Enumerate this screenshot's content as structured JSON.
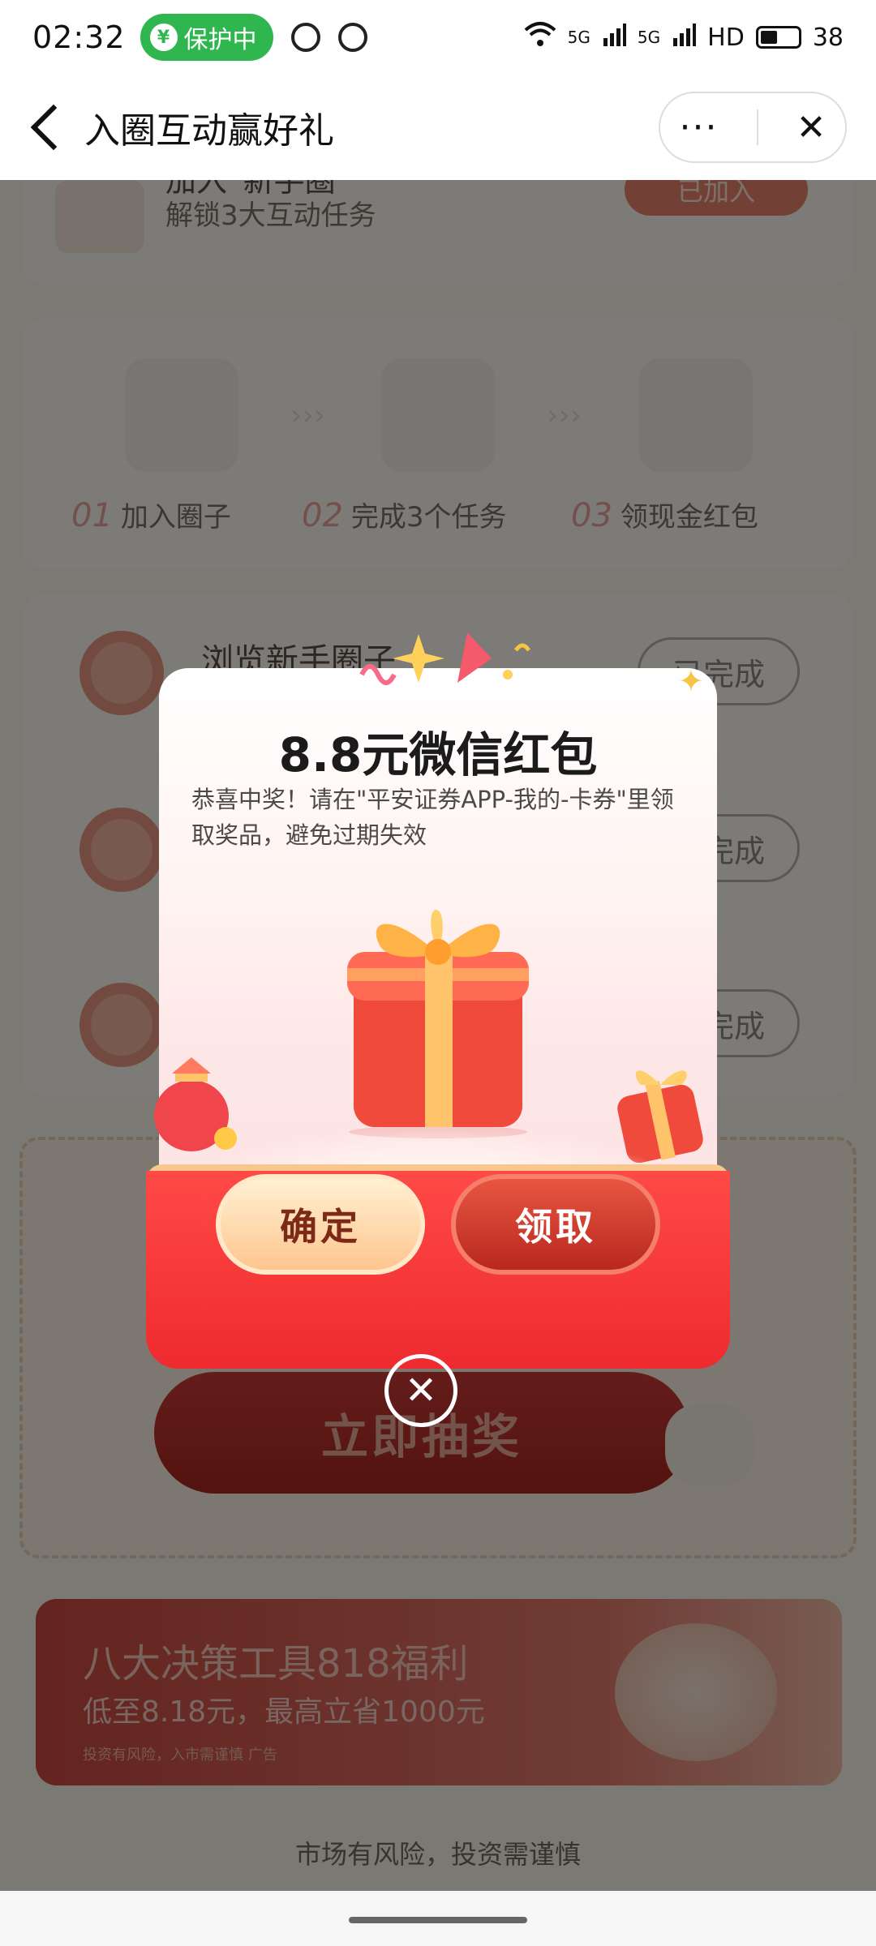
{
  "status_bar": {
    "time": "02:32",
    "protect_label": "保护中",
    "protect_icon": "shield-yen-icon",
    "battery": "38",
    "network_label": "5G",
    "hd_label": "HD"
  },
  "header": {
    "title": "入圈互动赢好礼",
    "more_label": "···",
    "close_label": "✕"
  },
  "background": {
    "card1": {
      "title": "加入“新手圈”",
      "subtitle": "解锁3大互动任务",
      "button": "已加入"
    },
    "steps": [
      {
        "num": "01",
        "label": "加入圈子"
      },
      {
        "num": "02",
        "label": "完成3个任务"
      },
      {
        "num": "03",
        "label": "领现金红包"
      }
    ],
    "tasks": [
      {
        "title": "浏览新手圈子",
        "button": "已完成"
      },
      {
        "title": "",
        "button": "已完成"
      },
      {
        "title": "",
        "button": "已完成"
      }
    ],
    "lottery_button": "立即抽奖",
    "banner": {
      "title": "八大决策工具818福利",
      "subtitle": "低至8.18元，最高立省1000元",
      "note": "投资有风险，入市需谨慎 广告"
    },
    "footer": "市场有风险，投资需谨慎"
  },
  "dialog": {
    "title": "8.8元微信红包",
    "description": "恭喜中奖！请在\"平安证券APP-我的-卡券\"里领取奖品，避免过期失效",
    "confirm_label": "确定",
    "claim_label": "领取",
    "close_label": "✕"
  }
}
